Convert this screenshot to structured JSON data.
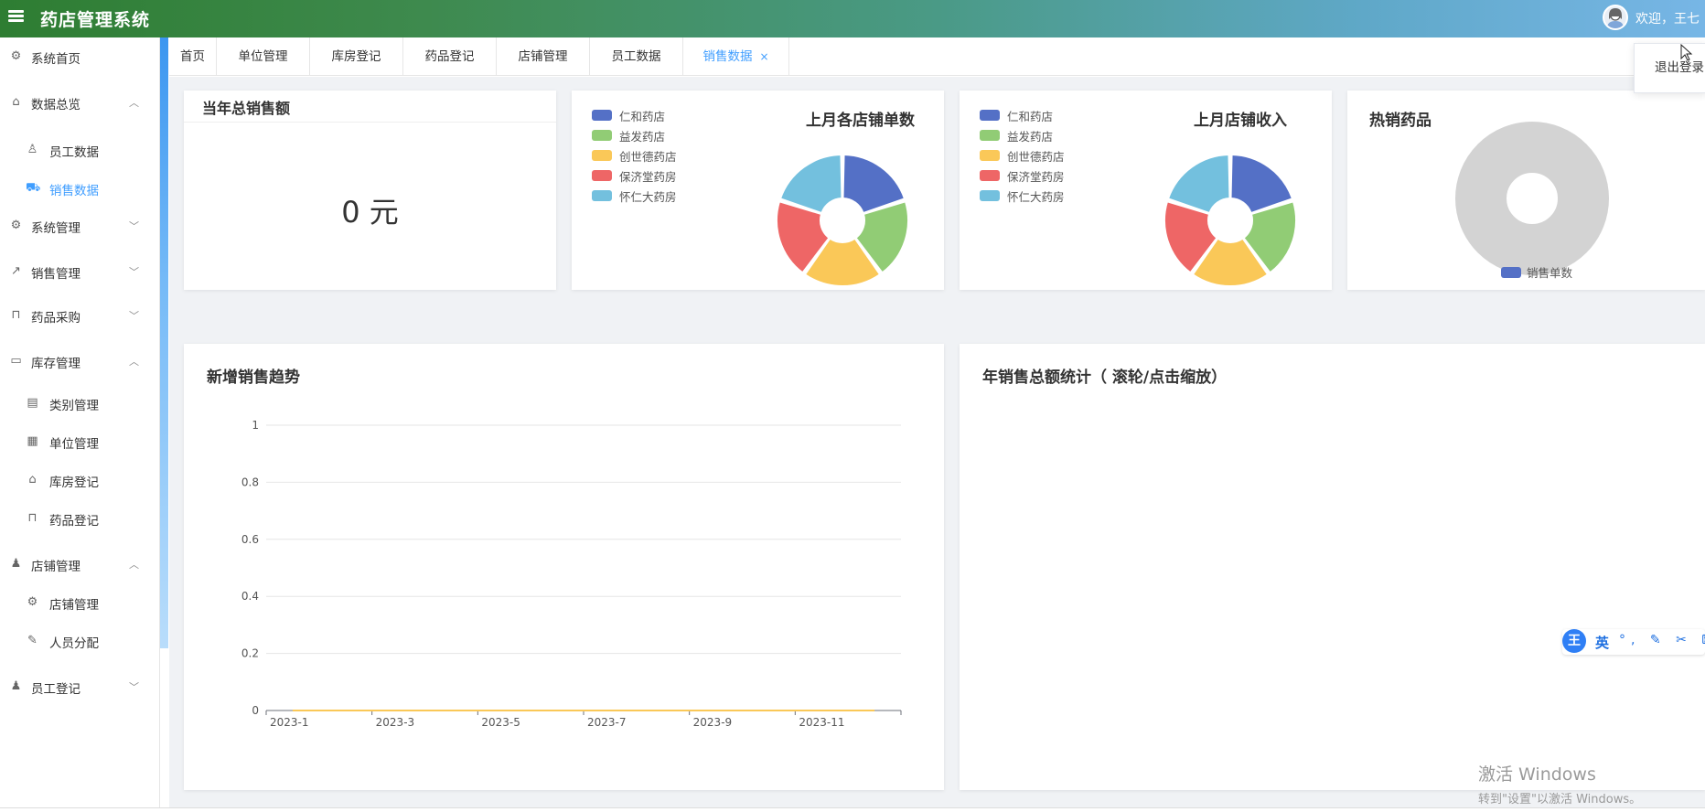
{
  "header": {
    "title": "药店管理系统",
    "welcome": "欢迎，王七"
  },
  "user_menu": {
    "logout": "退出登录"
  },
  "sidebar": {
    "items": [
      {
        "label": "系统首页",
        "icon": "gear-outline-icon"
      },
      {
        "label": "数据总览",
        "icon": "home-icon",
        "expanded": true
      },
      {
        "label": "员工数据",
        "icon": "user-icon",
        "sub": true
      },
      {
        "label": "销售数据",
        "icon": "truck-icon",
        "sub": true,
        "active": true
      },
      {
        "label": "系统管理",
        "icon": "gear-icon",
        "expanded": false
      },
      {
        "label": "销售管理",
        "icon": "trend-chart-icon",
        "expanded": false
      },
      {
        "label": "药品采购",
        "icon": "shopping-bag-icon",
        "expanded": false
      },
      {
        "label": "库存管理",
        "icon": "briefcase-icon",
        "expanded": true
      },
      {
        "label": "类别管理",
        "icon": "document-icon",
        "sub": true
      },
      {
        "label": "单位管理",
        "icon": "building-icon",
        "sub": true
      },
      {
        "label": "库房登记",
        "icon": "house-icon",
        "sub": true
      },
      {
        "label": "药品登记",
        "icon": "bag-icon",
        "sub": true
      },
      {
        "label": "店铺管理",
        "icon": "user-filled-icon",
        "expanded": true
      },
      {
        "label": "店铺管理",
        "icon": "gear-outline-icon",
        "sub": true
      },
      {
        "label": "人员分配",
        "icon": "edit-icon",
        "sub": true
      },
      {
        "label": "员工登记",
        "icon": "user-filled-icon",
        "expanded": false
      }
    ]
  },
  "tabs": [
    {
      "label": "首页"
    },
    {
      "label": "单位管理"
    },
    {
      "label": "库房登记"
    },
    {
      "label": "药品登记"
    },
    {
      "label": "店铺管理"
    },
    {
      "label": "员工数据"
    },
    {
      "label": "销售数据",
      "active": true,
      "close": "×"
    }
  ],
  "colors": {
    "blue": "#5470c6",
    "green": "#91cc75",
    "yellow": "#fac858",
    "red": "#ee6666",
    "cyan": "#73c0de",
    "empty": "#d3d3d3",
    "accent": "#409eff"
  },
  "cards": {
    "total_sales": {
      "title": "当年总销售额",
      "value": "0 元"
    },
    "orders_last_month": {
      "title": "上月各店铺单数"
    },
    "revenue_last_month": {
      "title": "上月店铺收入"
    },
    "hot_drugs": {
      "title": "热销药品"
    },
    "trend": {
      "title": "新增销售趋势"
    },
    "annual": {
      "title": "年销售总额统计（ 滚轮/点击缩放）"
    }
  },
  "chart_data": [
    {
      "type": "pie",
      "title": "上月各店铺单数",
      "legend_position": "top-left",
      "categories": [
        "仁和药店",
        "益发药店",
        "创世德药店",
        "保济堂药房",
        "怀仁大药房"
      ],
      "values": [
        1,
        1,
        1,
        1,
        1
      ]
    },
    {
      "type": "pie",
      "title": "上月店铺收入",
      "legend_position": "top-left",
      "categories": [
        "仁和药店",
        "益发药店",
        "创世德药店",
        "保济堂药房",
        "怀仁大药房"
      ],
      "values": [
        1,
        1,
        1,
        1,
        1
      ]
    },
    {
      "type": "pie",
      "title": "热销药品",
      "legend_position": "bottom",
      "series": [
        {
          "name": "销售单数",
          "values": []
        }
      ]
    },
    {
      "type": "line",
      "title": "新增销售趋势",
      "categories": [
        "2023-1",
        "2023-3",
        "2023-5",
        "2023-7",
        "2023-9",
        "2023-11"
      ],
      "yticks": [
        "1",
        "0.8",
        "0.6",
        "0.4",
        "0.2",
        "0"
      ],
      "ylim": [
        0,
        1
      ],
      "grid": true,
      "values": [
        0,
        0,
        0,
        0,
        0,
        0,
        0,
        0,
        0,
        0,
        0,
        0
      ]
    }
  ],
  "ime": {
    "logo": "王",
    "lang": "英",
    "tools": "°, ✎ ✂ ⌨"
  },
  "watermark": {
    "line1": "激活 Windows",
    "line2": "转到\"设置\"以激活 Windows。"
  }
}
